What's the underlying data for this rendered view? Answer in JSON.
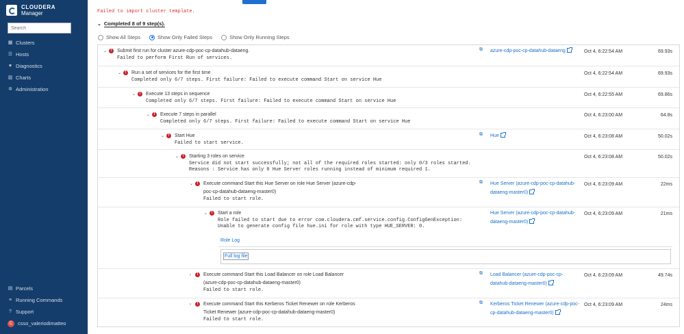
{
  "app": {
    "brand_line1": "CLOUDERA",
    "brand_line2": "Manager"
  },
  "sidebar": {
    "search_placeholder": "Search",
    "items": [
      {
        "label": "Clusters",
        "icon": "clusters-icon"
      },
      {
        "label": "Hosts",
        "icon": "hosts-icon"
      },
      {
        "label": "Diagnostics",
        "icon": "diagnostics-icon"
      },
      {
        "label": "Charts",
        "icon": "charts-icon"
      },
      {
        "label": "Administration",
        "icon": "gear-icon"
      }
    ],
    "bottom_items": [
      {
        "label": "Parcels",
        "icon": "parcels-icon"
      },
      {
        "label": "Running Commands",
        "icon": "running-commands-icon"
      },
      {
        "label": "Support",
        "icon": "support-icon"
      },
      {
        "label": "csso_valeriodimatteo",
        "icon": "avatar",
        "avatar_letter": "C"
      }
    ]
  },
  "main": {
    "error_text": "Failed to import cluster template.",
    "summary": "Completed 8 of 9 step(s).",
    "filters": [
      {
        "label": "Show All Steps",
        "checked": false
      },
      {
        "label": "Show Only Failed Steps",
        "checked": true
      },
      {
        "label": "Show Only Running Steps",
        "checked": false
      }
    ],
    "steps": [
      {
        "title": "Submit first run for cluster azure-cdp-poc-cp-datahub-dataeng.",
        "msg": "Failed to perform First Run of services.",
        "link": "azure-cdp-poc-cp-datahub-dataeng",
        "date": "Oct 4, 6:22:54 AM",
        "duration": "69.93s"
      },
      {
        "title": "Run a set of services for the first time",
        "msg": "Completed only 6/7 steps. First failure: Failed to execute command Start on service Hue",
        "link": "",
        "date": "Oct 4, 6:22:54 AM",
        "duration": "69.93s"
      },
      {
        "title": "Execute 13 steps in sequence",
        "msg": "Completed only 6/7 steps. First failure: Failed to execute command Start on service Hue",
        "link": "",
        "date": "Oct 4, 6:22:55 AM",
        "duration": "69.86s"
      },
      {
        "title": "Execute 7 steps in parallel",
        "msg": "Completed only 6/7 steps. First failure: Failed to execute command Start on service Hue",
        "link": "",
        "date": "Oct 4, 6:23:00 AM",
        "duration": "64.8s"
      },
      {
        "title": "Start Hue",
        "msg": "Failed to start service.",
        "link": "Hue",
        "date": "Oct 4, 6:23:08 AM",
        "duration": "50.02s"
      },
      {
        "title": "Starting 3 roles on service",
        "msg": "Service did not start successfully; not all of the required roles started: only 0/3 roles started.\nReasons : Service has only 0 Hue Server roles running instead of minimum required 1.",
        "link": "",
        "date": "Oct 4, 6:23:08 AM",
        "duration": "50.02s"
      },
      {
        "title_l1": "Execute command Start this Hue Server on role Hue Server (azure-cdp-",
        "title_l2": "poc-cp-datahub-dataeng-master0)",
        "msg": "Failed to start role.",
        "link_l1": "Hue Server (azure-cdp-poc-cp-datahub-",
        "link_l2": "dataeng-master0)",
        "date": "Oct 4, 6:23:09 AM",
        "duration": "22ms"
      },
      {
        "title": "Start a role",
        "msg": "Role failed to start due to error com.cloudera.cmf.service.config.ConfigGenException:\nUnable to generate config file hue.ini for role with type HUE_SERVER: 0.",
        "link_l1": "Hue Server (azure-cdp-poc-cp-datahub-",
        "link_l2": "dataeng-master0)",
        "date": "Oct 4, 6:23:09 AM",
        "duration": "21ms"
      },
      {
        "title_l1": "Execute command Start this Load Balancer on role Load Balancer",
        "title_l2": "(azure-cdp-poc-cp-datahub-dataeng-master0)",
        "msg": "Failed to start role.",
        "link_l1": "Load Balancer (azure-cdp-poc-cp-",
        "link_l2": "datahub-dataeng-master0)",
        "date": "Oct 4, 6:23:09 AM",
        "duration": "49.74s"
      },
      {
        "title_l1": "Execute command Start this Kerberos Ticket Renewer on role Kerberos",
        "title_l2": "Ticket Renewer (azure-cdp-poc-cp-datahub-dataeng-master0)",
        "msg": "Failed to start role.",
        "link_l1": "Kerberos Ticket Renewer (azure-cdp-poc-",
        "link_l2": "cp-datahub-dataeng-master0)",
        "date": "Oct 4, 6:23:09 AM",
        "duration": "24ms"
      }
    ],
    "role_log": {
      "tab": "Role Log",
      "full_log": "Full log file"
    }
  }
}
